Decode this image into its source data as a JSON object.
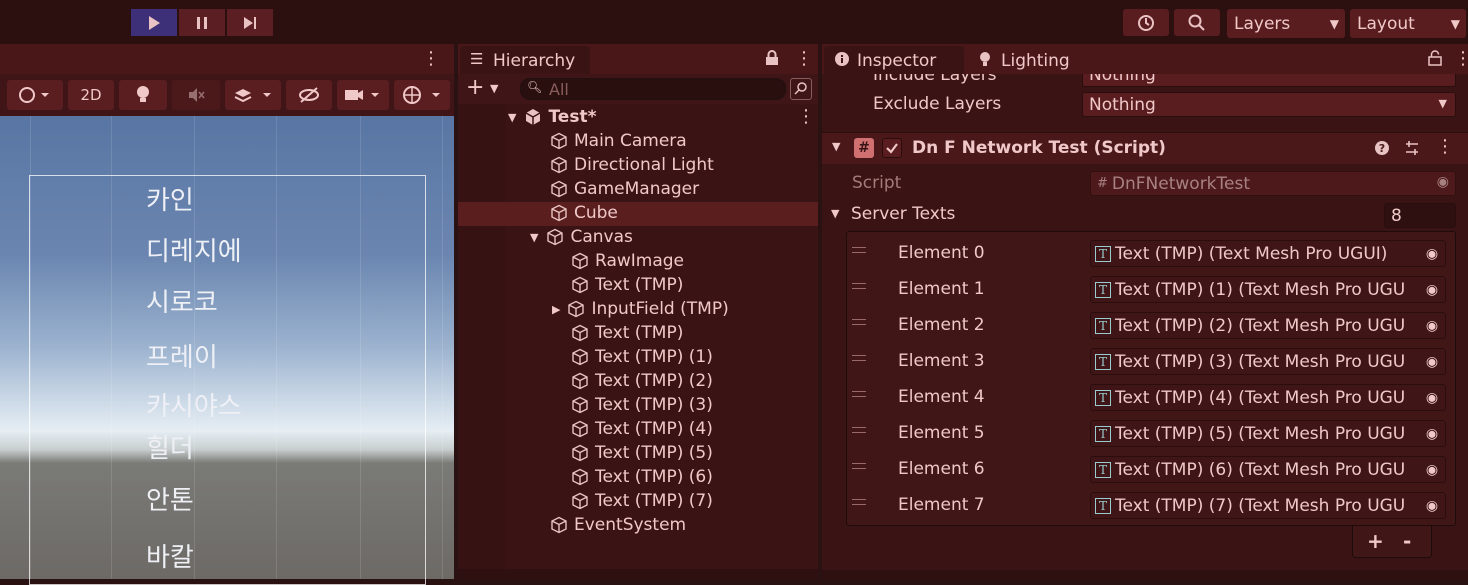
{
  "toolbar": {
    "layers_label": "Layers",
    "layout_label": "Layout",
    "play_icons": [
      "play-icon",
      "pause-icon",
      "step-icon"
    ]
  },
  "scene": {
    "mode_2d": "2D",
    "labels": [
      "카인",
      "디레지에",
      "시로코",
      "프레이",
      "카시야스",
      "힐더",
      "안톤",
      "바칼"
    ]
  },
  "hierarchy": {
    "tab": "Hierarchy",
    "search_placeholder": "All",
    "root": "Test*",
    "items": [
      {
        "label": "Main Camera"
      },
      {
        "label": "Directional Light"
      },
      {
        "label": "GameManager"
      },
      {
        "label": "Cube"
      },
      {
        "label": "Canvas"
      },
      {
        "label": "RawImage"
      },
      {
        "label": "Text (TMP)"
      },
      {
        "label": "InputField (TMP)"
      },
      {
        "label": "Text (TMP)"
      },
      {
        "label": "Text (TMP) (1)"
      },
      {
        "label": "Text (TMP) (2)"
      },
      {
        "label": "Text (TMP) (3)"
      },
      {
        "label": "Text (TMP) (4)"
      },
      {
        "label": "Text (TMP) (5)"
      },
      {
        "label": "Text (TMP) (6)"
      },
      {
        "label": "Text (TMP) (7)"
      },
      {
        "label": "EventSystem"
      }
    ]
  },
  "inspector": {
    "tab_inspector": "Inspector",
    "tab_lighting": "Lighting",
    "include_layers_label": "Include Layers",
    "include_layers_value": "Nothing",
    "exclude_layers_label": "Exclude Layers",
    "exclude_layers_value": "Nothing",
    "component_title": "Dn F Network Test (Script)",
    "script_label": "Script",
    "script_value": "DnFNetworkTest",
    "server_texts_label": "Server Texts",
    "server_texts_count": "8",
    "elements": [
      {
        "label": "Element 0",
        "value": "Text (TMP) (Text Mesh Pro UGUI)"
      },
      {
        "label": "Element 1",
        "value": "Text (TMP) (1) (Text Mesh Pro UGU"
      },
      {
        "label": "Element 2",
        "value": "Text (TMP) (2) (Text Mesh Pro UGU"
      },
      {
        "label": "Element 3",
        "value": "Text (TMP) (3) (Text Mesh Pro UGU"
      },
      {
        "label": "Element 4",
        "value": "Text (TMP) (4) (Text Mesh Pro UGU"
      },
      {
        "label": "Element 5",
        "value": "Text (TMP) (5) (Text Mesh Pro UGU"
      },
      {
        "label": "Element 6",
        "value": "Text (TMP) (6) (Text Mesh Pro UGU"
      },
      {
        "label": "Element 7",
        "value": "Text (TMP) (7) (Text Mesh Pro UGU"
      }
    ],
    "add_label": "+",
    "remove_label": "-"
  }
}
